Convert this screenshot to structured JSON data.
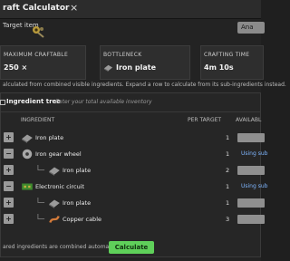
{
  "window": {
    "title": "raft Calculator",
    "close_glyph": "×"
  },
  "target": {
    "label": "Target item",
    "icon": "gear-item-icon",
    "button_label": "Ana"
  },
  "stats": [
    {
      "label": "MAXIMUM CRAFTABLE",
      "value": "250 ×"
    },
    {
      "label": "BOTTLENECK",
      "value": "Iron plate",
      "icon": "iron-plate-icon"
    },
    {
      "label": "CRAFTING TIME",
      "value": "4m 10s"
    }
  ],
  "info_text": "alculated from combined visible ingredients. Expand a row to calculate from its sub-ingredients instead.",
  "tree": {
    "title": "Ingredient tree",
    "hint": "Enter your total available inventory",
    "columns": {
      "ingredient": "INGREDIENT",
      "per_target": "PER TARGET",
      "available": "AVAILABL"
    },
    "rows": [
      {
        "button": "+",
        "name": "Iron plate",
        "qty": "1",
        "link": "",
        "icon": "iron-plate-icon",
        "level": 0
      },
      {
        "button": "−",
        "name": "Iron gear wheel",
        "qty": "1",
        "link": "Using sub",
        "icon": "iron-gear-icon",
        "level": 0
      },
      {
        "button": "+",
        "name": "Iron plate",
        "qty": "2",
        "link": "",
        "icon": "iron-plate-icon",
        "level": 1
      },
      {
        "button": "−",
        "name": "Electronic circuit",
        "qty": "1",
        "link": "Using sub",
        "icon": "circuit-icon",
        "level": 0
      },
      {
        "button": "+",
        "name": "Iron plate",
        "qty": "1",
        "link": "",
        "icon": "iron-plate-icon",
        "level": 1
      },
      {
        "button": "+",
        "name": "Copper cable",
        "qty": "3",
        "link": "",
        "icon": "copper-cable-icon",
        "level": 1
      }
    ]
  },
  "footer": {
    "text": "ared ingredients are combined automatically.",
    "calculate_label": "Calculate"
  },
  "colors": {
    "accent_green": "#5fd05a",
    "link_blue": "#7fb6ff",
    "panel": "#232323"
  }
}
